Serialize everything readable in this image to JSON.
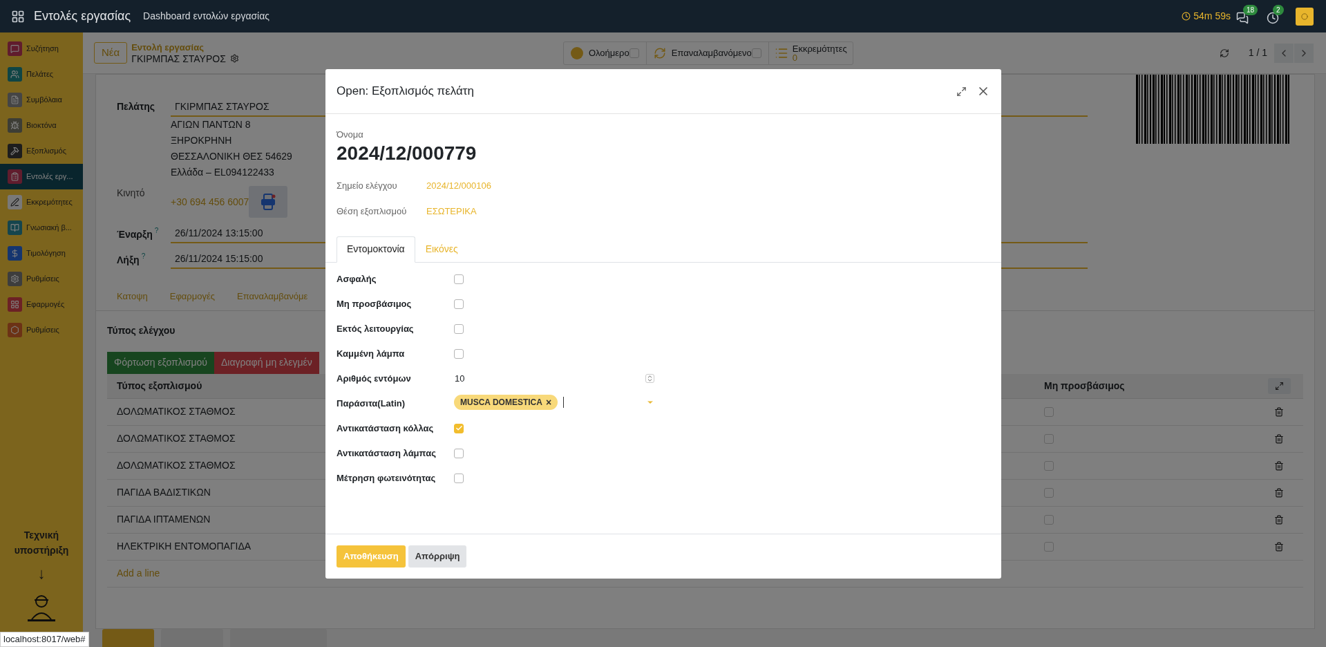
{
  "topbar": {
    "app_title": "Εντολές εργασίας",
    "menu": "Dashboard εντολών εργασίας",
    "timer": "54m 59s",
    "messages_count": "18",
    "activities_count": "2"
  },
  "sidebar": {
    "items": [
      {
        "kind": "chat",
        "label": "Συζήτηση",
        "selected": false
      },
      {
        "kind": "users",
        "label": "Πελάτες",
        "selected": false
      },
      {
        "kind": "contract",
        "label": "Συμβόλαια",
        "selected": false
      },
      {
        "kind": "biocide",
        "label": "Βιοκτόνα",
        "selected": false
      },
      {
        "kind": "tools",
        "label": "Εξοπλισμός",
        "selected": false
      },
      {
        "kind": "orders",
        "label": "Εντολές εργ...",
        "selected": true
      },
      {
        "kind": "pending",
        "label": "Εκκρεμότητες",
        "selected": false
      },
      {
        "kind": "book",
        "label": "Γνωσιακή β...",
        "selected": false
      },
      {
        "kind": "invoice",
        "label": "Τιμολόγηση",
        "selected": false
      },
      {
        "kind": "settings",
        "label": "Ρυθμίσεις",
        "selected": false
      },
      {
        "kind": "apps",
        "label": "Εφαρμογές",
        "selected": false
      },
      {
        "kind": "brand",
        "label": "Ρυθμίσεις",
        "selected": false
      }
    ],
    "support_label": "Τεχνική υποστήριξη",
    "arrow": "↓"
  },
  "control_panel": {
    "new_button": "Νέα",
    "breadcrumb_parent": "Εντολή εργασίας",
    "breadcrumb_current": "ΓΚΙΡΜΠΑΣ ΣΤΑΥΡΟΣ",
    "toggles": [
      {
        "kind": "dot",
        "label": "Ολοήμερο",
        "checked": false
      },
      {
        "kind": "repeat",
        "label": "Επαναλαμβανόμενο",
        "checked": false
      }
    ],
    "pending": {
      "label": "Εκκρεμότητες",
      "count": "0"
    },
    "pager": "1 / 1"
  },
  "form": {
    "customer_label": "Πελάτης",
    "customer": "ΓΚΙΡΜΠΑΣ ΣΤΑΥΡΟΣ",
    "address": [
      "ΑΓΙΩΝ ΠΑΝΤΩΝ 8",
      "ΞΗΡΟΚΡΗΝΗ",
      "ΘΕΣΣΑΛΟΝΙΚΗ ΘΕΣ 54629",
      "Ελλάδα – EL094122433"
    ],
    "mobile_label": "Κινητό",
    "mobile": "+30 694 456 6007",
    "start_label": "Έναρξη",
    "start_help": "?",
    "start": "26/11/2024 13:15:00",
    "end_label": "Λήξη",
    "end_help": "?",
    "end": "26/11/2024 15:15:00",
    "tabs": [
      {
        "label": "Κατοψη"
      },
      {
        "label": "Εφαρμογές"
      },
      {
        "label": "Επαναλαμβανόμε"
      }
    ],
    "section_title": "Τύπος ελέγχου",
    "load_button": "Φόρτωση εξοπλισμού",
    "delete_button": "Διαγραφή μη ελεγμέν",
    "table": {
      "columns": [
        "Τύπος εξοπλισμού",
        "Μη προσβάσιμος"
      ],
      "rows": [
        {
          "name": "ΔΟΛΩΜΑΤΙΚΟΣ ΣΤΑΘΜΟΣ",
          "checked": false
        },
        {
          "name": "ΔΟΛΩΜΑΤΙΚΟΣ ΣΤΑΘΜΟΣ",
          "checked": false
        },
        {
          "name": "ΔΟΛΩΜΑΤΙΚΟΣ ΣΤΑΘΜΟΣ",
          "checked": false
        },
        {
          "name": "ΠΑΓΙΔΑ ΒΑΔΙΣΤΙΚΩΝ",
          "checked": false
        },
        {
          "name": "ΠΑΓΙΔΑ ΙΠΤΑΜΕΝΩΝ",
          "checked": false
        },
        {
          "name": "ΗΛΕΚΤΡΙΚΗ ΕΝΤΟΜΟΠΑΓΙΔΑ",
          "checked": false
        }
      ],
      "add_line": "Add a line"
    }
  },
  "dialog": {
    "title": "Open: Εξοπλισμός πελάτη",
    "name_label": "Όνομα",
    "name": "2024/12/000779",
    "links": [
      {
        "label": "Σημείο ελέγχου",
        "value": "2024/12/000106"
      },
      {
        "label": "Θέση εξοπλισμού",
        "value": "ΕΣΩΤΕΡΙΚΑ"
      }
    ],
    "tabs": [
      {
        "label": "Εντομοκτονία",
        "selected": true
      },
      {
        "label": "Εικόνες",
        "selected": false
      }
    ],
    "fields": [
      {
        "kind": "checkbox",
        "label": "Ασφαλής",
        "checked": false
      },
      {
        "kind": "checkbox",
        "label": "Μη προσβάσιμος",
        "checked": false
      },
      {
        "kind": "checkbox",
        "label": "Εκτός λειτουργίας",
        "checked": false
      },
      {
        "kind": "checkbox",
        "label": "Καμμένη λάμπα",
        "checked": false
      },
      {
        "kind": "number",
        "label": "Αριθμός εντόμων",
        "value": "10"
      },
      {
        "kind": "tags",
        "label": "Παράσιτα(Latin)",
        "tags": [
          "MUSCA DOMESTICA"
        ],
        "remove": "×"
      },
      {
        "kind": "checkbox",
        "label": "Αντικατάσταση κόλλας",
        "checked": true
      },
      {
        "kind": "checkbox",
        "label": "Αντικατάσταση λάμπας",
        "checked": false
      },
      {
        "kind": "checkbox",
        "label": "Μέτρηση φωτεινότητας",
        "checked": false
      }
    ],
    "buttons": [
      {
        "kind": "primary",
        "label": "Αποθήκευση"
      },
      {
        "kind": "secondary",
        "label": "Απόρριψη"
      }
    ]
  },
  "status_url": "localhost:8017/web#"
}
